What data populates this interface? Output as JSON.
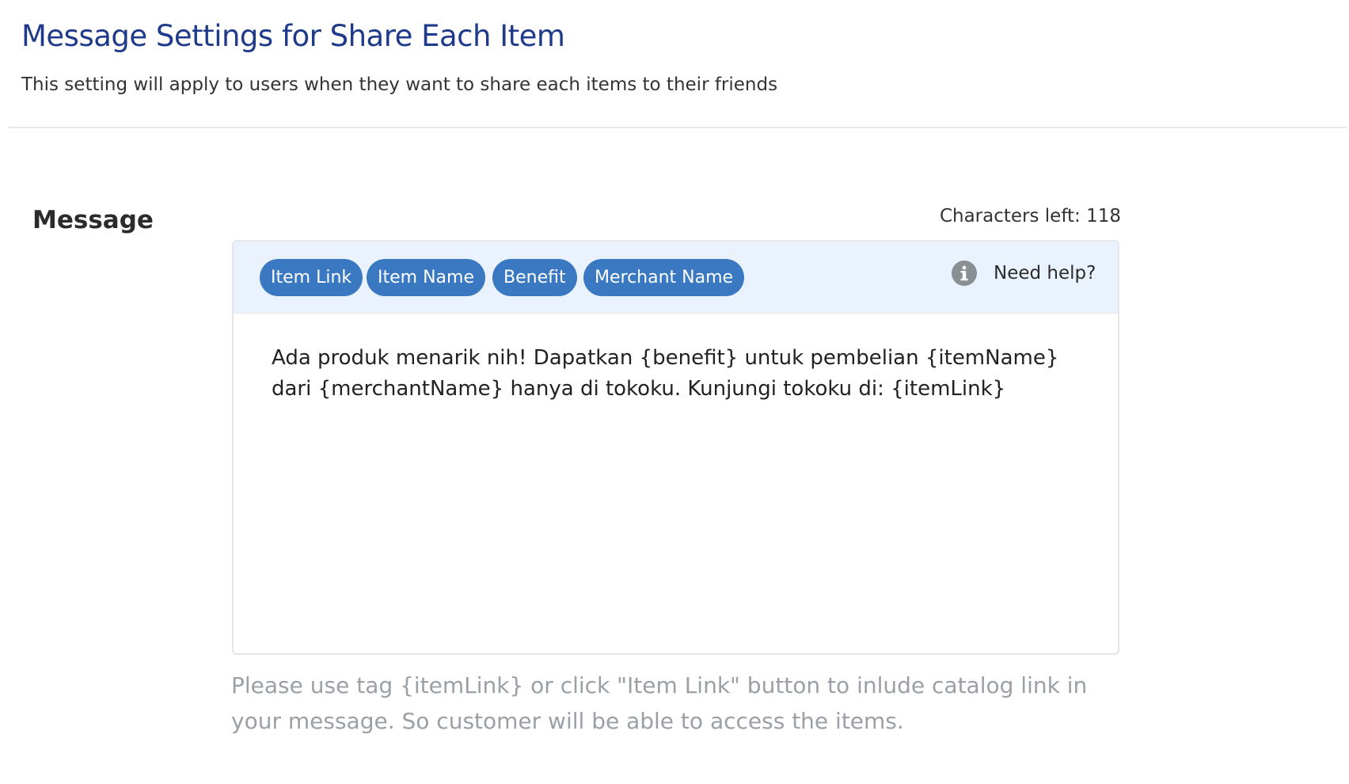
{
  "header": {
    "title": "Message Settings for Share Each Item",
    "subtitle": "This setting will apply to users when they want to share each items to their friends"
  },
  "message_field": {
    "label": "Message",
    "characters_left": "Characters left: 118",
    "tag_buttons": [
      {
        "label": "Item Link"
      },
      {
        "label": "Item Name"
      },
      {
        "label": "Benefit"
      },
      {
        "label": "Merchant Name"
      }
    ],
    "help": {
      "icon": "info-icon",
      "label": "Need help?"
    },
    "value": "Ada produk menarik nih! Dapatkan {benefit} untuk pembelian {itemName} dari {merchantName} hanya di tokoku. Kunjungi tokoku di: {itemLink}",
    "hint": "Please use tag {itemLink} or click \"Item Link\" button to inlude catalog link in your message. So customer will be able to access the items."
  },
  "colors": {
    "title": "#1f3a8a",
    "tag_button_bg": "#3a78c2",
    "toolbar_bg": "#eaf3fd",
    "hint_text": "#9aa0a6",
    "info_icon": "#8a8f94"
  }
}
